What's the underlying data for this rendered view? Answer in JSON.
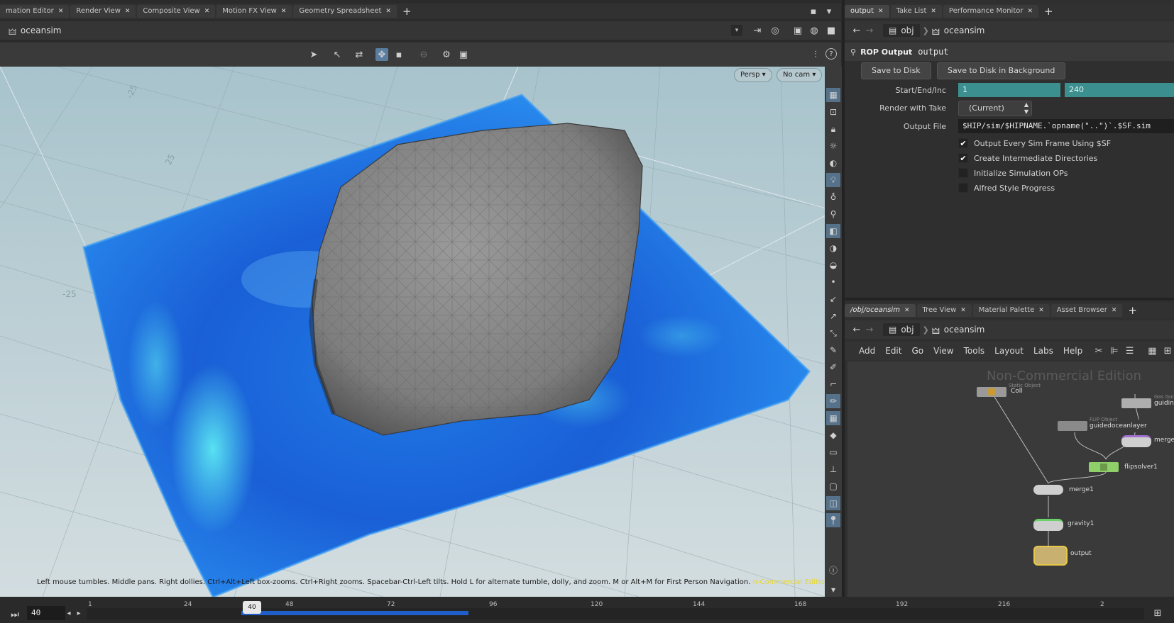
{
  "top_tabs": [
    {
      "label": "mation Editor"
    },
    {
      "label": "Render View"
    },
    {
      "label": "Composite View"
    },
    {
      "label": "Motion FX View"
    },
    {
      "label": "Geometry Spreadsheet"
    }
  ],
  "right_top_tabs": [
    {
      "label": "output"
    },
    {
      "label": "Take List"
    },
    {
      "label": "Performance Monitor"
    }
  ],
  "viewport": {
    "path": "oceansim",
    "persp_label": "Persp",
    "cam_label": "No cam",
    "grid_labels": [
      "-25",
      "25",
      "-25"
    ],
    "status_hint": "Left mouse tumbles. Middle pans. Right dollies. Ctrl+Alt+Left box-zooms. Ctrl+Right zooms. Spacebar-Ctrl-Left tilts. Hold L for alternate tumble, dolly, and zoom.     M or Alt+M for First Person Navigation.",
    "watermark_small": "n-Commercial Edition"
  },
  "param_panel": {
    "path_root": "obj",
    "path_node": "oceansim",
    "node_type": "ROP Output",
    "node_name": "output",
    "save_to_disk": "Save to Disk",
    "save_bg": "Save to Disk in Background",
    "start_end_label": "Start/End/Inc",
    "start_value": "1",
    "end_value": "240",
    "render_take_label": "Render with Take",
    "render_take_value": "(Current)",
    "output_file_label": "Output File",
    "output_file_value": "$HIP/sim/$HIPNAME.`opname(\"..\")`.$SF.sim",
    "checkboxes": [
      {
        "label": "Output Every Sim Frame Using $SF",
        "checked": true
      },
      {
        "label": "Create Intermediate Directories",
        "checked": true
      },
      {
        "label": "Initialize Simulation OPs",
        "checked": false
      },
      {
        "label": "Alfred Style Progress",
        "checked": false
      }
    ]
  },
  "network_tabs": [
    {
      "label": "/obj/oceansim"
    },
    {
      "label": "Tree View"
    },
    {
      "label": "Material Palette"
    },
    {
      "label": "Asset Browser"
    }
  ],
  "network": {
    "path_root": "obj",
    "path_node": "oceansim",
    "menu": [
      "Add",
      "Edit",
      "Go",
      "View",
      "Tools",
      "Layout",
      "Labs",
      "Help"
    ],
    "watermark": "Non-Commercial Edition",
    "nodes": {
      "coll": {
        "name": "Coll",
        "type": "Static Object"
      },
      "guiding": {
        "name": "guidin",
        "type": "Gas Gui"
      },
      "guidedoceanlayer": {
        "name": "guidedoceanlayer",
        "type": "FLIP Object"
      },
      "merge_r": {
        "name": "merge"
      },
      "flipsolver": {
        "name": "flipsolver1"
      },
      "merge1": {
        "name": "merge1"
      },
      "gravity": {
        "name": "gravity1"
      },
      "output": {
        "name": "output"
      }
    }
  },
  "timeline": {
    "current_frame": "40",
    "ticks": [
      "1",
      "24",
      "48",
      "72",
      "96",
      "120",
      "144",
      "168",
      "192",
      "216",
      "2"
    ]
  }
}
